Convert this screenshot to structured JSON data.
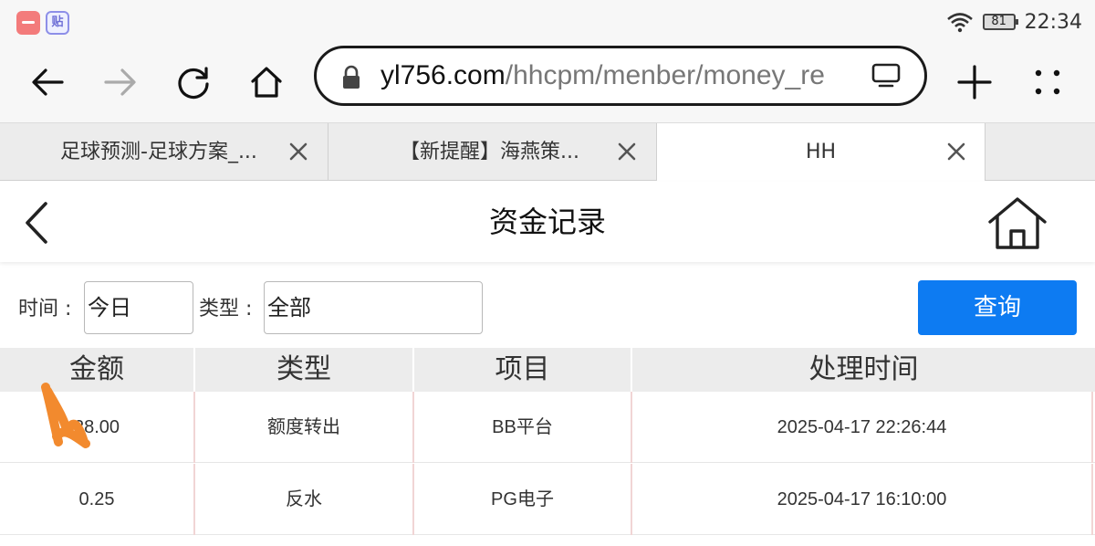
{
  "status_bar": {
    "battery": "81",
    "time": "22:34",
    "icons": [
      "shop-app-icon",
      "tie-app-icon",
      "wifi-icon",
      "battery-icon"
    ],
    "tie_app_glyph": "贴"
  },
  "browser": {
    "url_host": "yl756.com",
    "url_path": "/hhcpm/menber/money_re",
    "toolbar_icons": [
      "back-arrow-icon",
      "forward-arrow-icon",
      "reload-icon",
      "home-icon",
      "lock-icon",
      "screen-icon",
      "new-tab-plus-icon",
      "menu-dots-icon"
    ],
    "tabs": [
      {
        "label": "足球预测-足球方案_...",
        "active": false
      },
      {
        "label": "【新提醒】海燕策...",
        "active": false
      },
      {
        "label": "HH",
        "active": true
      }
    ]
  },
  "app": {
    "title": "资金记录",
    "filters": {
      "time_label": "时间 :",
      "time_value": "今日",
      "type_label": "类型 :",
      "type_value": "全部",
      "query_label": "查询"
    },
    "table": {
      "columns": [
        "金额",
        "类型",
        "项目",
        "处理时间"
      ],
      "rows": [
        {
          "amount": "28.00",
          "type": "额度转出",
          "project": "BB平台",
          "time": "2025-04-17 22:26:44"
        },
        {
          "amount": "0.25",
          "type": "反水",
          "project": "PG电子",
          "time": "2025-04-17 16:10:00"
        }
      ]
    }
  },
  "colors": {
    "accent_button": "#0d7bf2",
    "scribble": "#f28a2e"
  }
}
